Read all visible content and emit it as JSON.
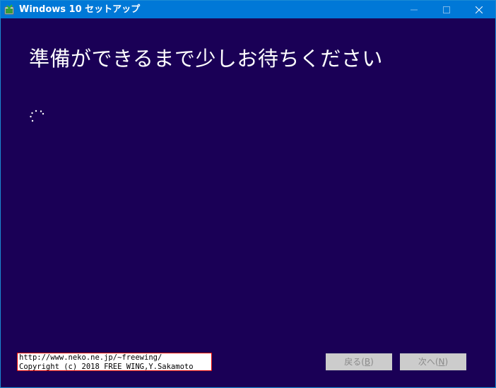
{
  "window": {
    "title": "Windows 10 セットアップ"
  },
  "main": {
    "heading": "準備ができるまで少しお待ちください"
  },
  "watermark": {
    "line1": "http://www.neko.ne.jp/~freewing/",
    "line2": "Copyright (c) 2018 FREE WING,Y.Sakamoto"
  },
  "buttons": {
    "back": {
      "label": "戻る(",
      "accel": "B",
      "suffix": ")"
    },
    "next": {
      "label": "次へ(",
      "accel": "N",
      "suffix": ")"
    }
  },
  "icons": {
    "app": "setup-app-icon",
    "minimize": "minimize-icon",
    "maximize": "maximize-icon",
    "close": "close-icon",
    "spinner": "loading-spinner-icon"
  },
  "colors": {
    "titlebar": "#0078d7",
    "background": "#1a0056",
    "button_disabled_bg": "#cccccc",
    "button_disabled_text": "#8a8a8a"
  }
}
